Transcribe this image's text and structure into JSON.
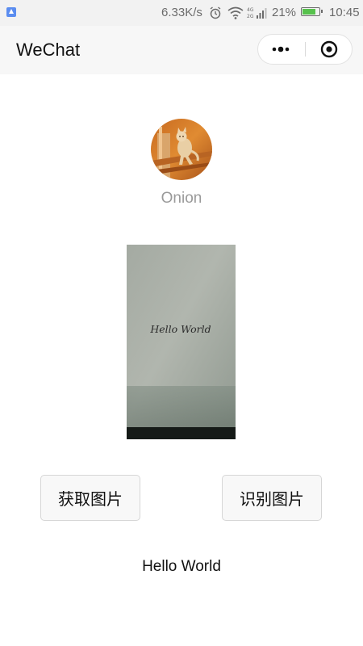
{
  "status_bar": {
    "network_speed": "6.33K/s",
    "network_type": "4G",
    "battery_percent": "21%",
    "battery_level": 0.21,
    "time": "10:45",
    "icons": [
      "app-notification-icon",
      "alarm-icon",
      "wifi-icon",
      "cell-signal-icon",
      "battery-icon"
    ]
  },
  "nav_bar": {
    "title": "WeChat",
    "capsule_buttons": [
      "more-icon",
      "close-miniprogram-icon"
    ]
  },
  "profile": {
    "nickname": "Onion",
    "avatar_icon": "cat-avatar-icon"
  },
  "photo": {
    "handwritten_text": "Hello World"
  },
  "buttons": {
    "get_image": "获取图片",
    "recognize_image": "识别图片"
  },
  "result": {
    "text": "Hello World"
  },
  "colors": {
    "status_bar_bg": "#f2f2f2",
    "nav_bg": "#f7f7f7",
    "battery_green": "#57c24d",
    "nickname_gray": "#9a9a9a"
  }
}
